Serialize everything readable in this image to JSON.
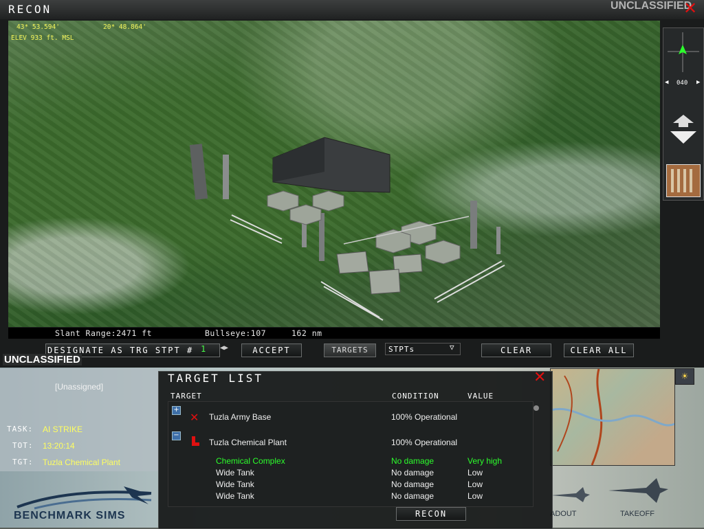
{
  "window": {
    "title": "RECON",
    "classification_top": "UNCLASSIFIED",
    "classification_bottom": "UNCLASSIFIED"
  },
  "hud": {
    "lat": "43* 53.594'",
    "lon": "20* 48.864'",
    "elevation": "ELEV 933 ft. MSL"
  },
  "status": {
    "slant_range": "Slant Range:2471 ft",
    "bullseye": "Bullseye:107",
    "distance": "162 nm"
  },
  "compass": {
    "heading": "040"
  },
  "controls": {
    "designate_label": "DESIGNATE AS TRG STPT #",
    "stpt_number": "1",
    "accept_label": "ACCEPT",
    "targets_label": "TARGETS",
    "stpts_select": "STPTs",
    "clear_label": "CLEAR",
    "clear_all_label": "CLEAR ALL"
  },
  "mission": {
    "assignment": "[Unassigned]",
    "task_label": "TASK:",
    "task_value": "AI STRIKE",
    "tot_label": "TOT:",
    "tot_value": "13:20:14",
    "tgt_label": "TGT:",
    "tgt_value": "Tuzla Chemical Plant",
    "logo": "BENCHMARK SIMS",
    "loadout_label": "ADOUT",
    "takeoff_label": "TAKEOFF"
  },
  "target_list": {
    "title": "TARGET LIST",
    "headers": {
      "target": "TARGET",
      "condition": "CONDITION",
      "value": "VALUE"
    },
    "groups": [
      {
        "name": "Tuzla Army Base",
        "condition": "100% Operational",
        "expanded": false
      },
      {
        "name": "Tuzla Chemical Plant",
        "condition": "100% Operational",
        "expanded": true
      }
    ],
    "items": [
      {
        "name": "Chemical Complex",
        "condition": "No damage",
        "value": "Very high"
      },
      {
        "name": "Wide Tank",
        "condition": "No damage",
        "value": "Low"
      },
      {
        "name": "Wide Tank",
        "condition": "No damage",
        "value": "Low"
      },
      {
        "name": "Wide Tank",
        "condition": "No damage",
        "value": "Low"
      }
    ],
    "recon_label": "RECON"
  },
  "colors": {
    "highlight": "#2cff2c",
    "hud": "#f3f35a",
    "close": "#e01010"
  }
}
